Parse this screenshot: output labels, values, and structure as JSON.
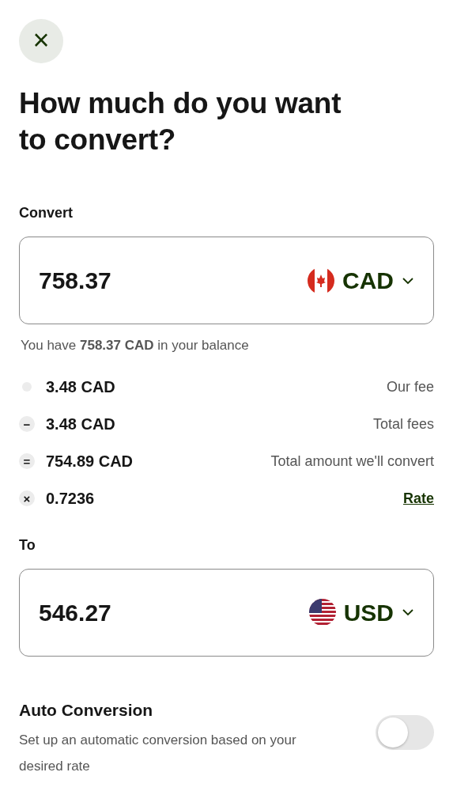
{
  "close_button": {
    "symbol": "×"
  },
  "title": "How much do you want to convert?",
  "convert": {
    "label": "Convert",
    "amount": "758.37",
    "currency": "CAD"
  },
  "balance_note": "You have **758.37 CAD** in your balance",
  "fees": [
    {
      "kind": "dot",
      "amount": "3.48 CAD",
      "label": "Our fee",
      "link": false
    },
    {
      "kind": "minus",
      "symbol": "−",
      "amount": "3.48 CAD",
      "label": "Total fees",
      "link": false
    },
    {
      "kind": "equals",
      "symbol": "=",
      "amount": "754.89 CAD",
      "label": "Total amount we'll convert",
      "link": false
    },
    {
      "kind": "times",
      "symbol": "×",
      "amount": "0.7236",
      "label": "Rate",
      "link": true
    }
  ],
  "to": {
    "label": "To",
    "amount": "546.27",
    "currency": "USD"
  },
  "auto_conversion": {
    "title": "Auto Conversion",
    "description": "Set up an automatic conversion based on your desired rate",
    "on": false
  }
}
